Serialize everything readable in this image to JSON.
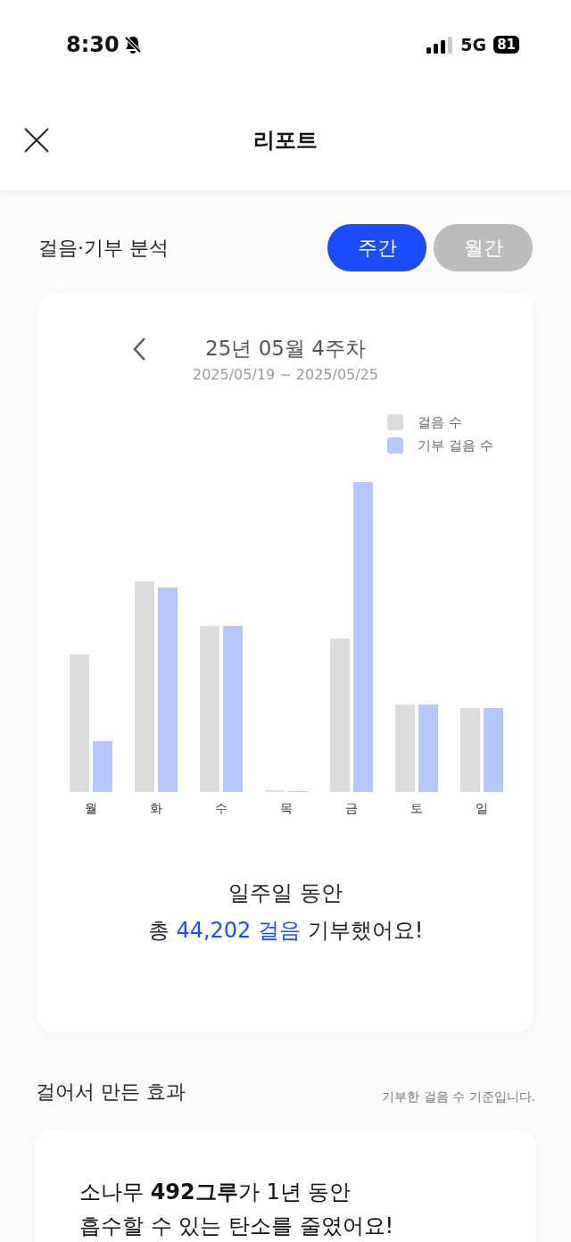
{
  "status_bar": {
    "time": "8:30",
    "network": "5G",
    "battery": "81"
  },
  "header": {
    "title": "리포트"
  },
  "analysis": {
    "title": "걸음·기부 분석",
    "tabs": [
      {
        "label": "주간",
        "selected": true
      },
      {
        "label": "월간",
        "selected": false
      }
    ],
    "period": {
      "title": "25년 05월 4주차",
      "range": "2025/05/19 ~ 2025/05/25"
    },
    "legend": [
      {
        "label": "걸음 수",
        "color": "#dcdcdc"
      },
      {
        "label": "기부 걸음 수",
        "color": "#b4c8ff"
      }
    ],
    "chart": {
      "kind": "picture",
      "day_labels": [
        "월",
        "화",
        "수",
        "목",
        "금",
        "토",
        "일"
      ]
    },
    "summary": {
      "line_1": "일주일 동안",
      "line_2_start": "총",
      "line_2_highlight": "44,202 걸음",
      "line_2_end": "기부했어요!"
    }
  },
  "effect": {
    "title": "걸어서 만든 효과",
    "note": "기부한 걸음 수 기준입니다.",
    "text_1": "소나무 **492그루**가 1년 동안",
    "text_2": "흡수할 수 있는 탄소를 줄였어요!"
  }
}
